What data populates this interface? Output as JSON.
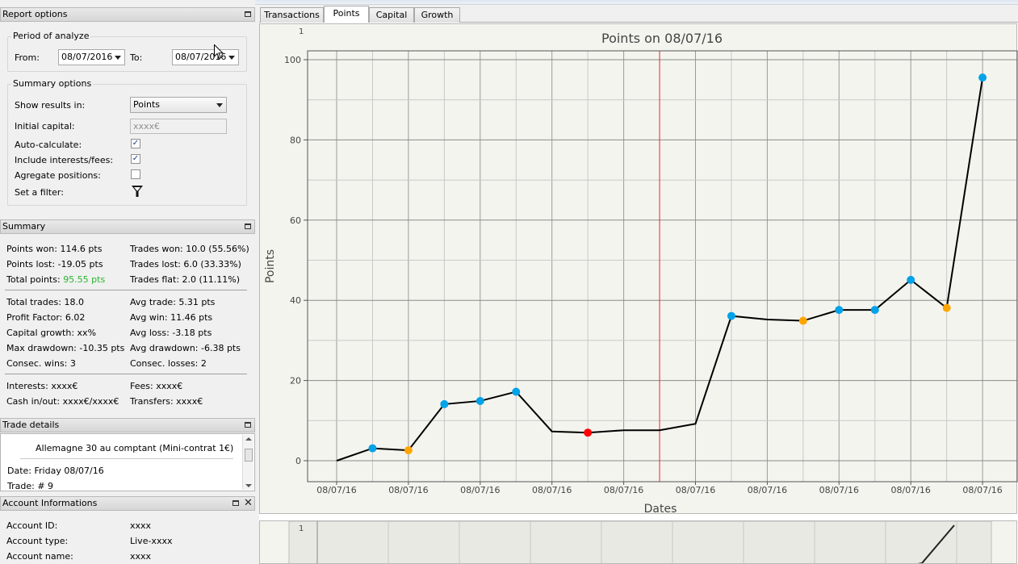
{
  "report_options": {
    "title": "Report options",
    "period": {
      "title": "Period of analyze",
      "from_label": "From:",
      "from_value": "08/07/2016",
      "to_label": "To:",
      "to_value": "08/07/2016"
    },
    "summary_options": {
      "title": "Summary options",
      "show_results_label": "Show results in:",
      "show_results_value": "Points",
      "initial_capital_label": "Initial capital:",
      "initial_capital_placeholder": "xxxx€",
      "auto_calculate_label": "Auto-calculate:",
      "auto_calculate_checked": true,
      "include_interests_label": "Include interests/fees:",
      "include_interests_checked": true,
      "aggregate_label": "Agregate positions:",
      "aggregate_checked": false,
      "filter_label": "Set a filter:"
    }
  },
  "summary": {
    "title": "Summary",
    "points_won": "Points won: 114.6 pts",
    "trades_won": "Trades won: 10.0 (55.56%)",
    "points_lost": "Points lost: -19.05 pts",
    "trades_lost": "Trades lost: 6.0 (33.33%)",
    "total_points_label": "Total points:",
    "total_points_value": "95.55 pts",
    "trades_flat": "Trades flat: 2.0 (11.11%)",
    "total_trades": "Total trades: 18.0",
    "avg_trade": "Avg trade: 5.31 pts",
    "profit_factor": "Profit Factor: 6.02",
    "avg_win": "Avg win: 11.46 pts",
    "capital_growth": "Capital growth: xx%",
    "avg_loss": "Avg loss: -3.18 pts",
    "max_drawdown": "Max drawdown: -10.35 pts",
    "avg_drawdown": "Avg drawdown: -6.38 pts",
    "consec_wins": "Consec. wins: 3",
    "consec_losses": "Consec. losses: 2",
    "interests": "Interests: xxxx€",
    "fees": "Fees: xxxx€",
    "cash_inout": "Cash in/out: xxxx€/xxxx€",
    "transfers": "Transfers: xxxx€"
  },
  "trade_details": {
    "title": "Trade details",
    "instrument": "Allemagne 30 au comptant (Mini-contrat 1€)",
    "date": "Date: Friday 08/07/16",
    "trade": "Trade: # 9"
  },
  "account": {
    "title": "Account Informations",
    "rows": [
      {
        "label": "Account ID:",
        "value": "xxxx"
      },
      {
        "label": "Account type:",
        "value": "Live-xxxx"
      },
      {
        "label": "Account name:",
        "value": "xxxx"
      }
    ]
  },
  "tabs": [
    {
      "label": "Transactions",
      "active": false
    },
    {
      "label": "Points",
      "active": true
    },
    {
      "label": "Capital",
      "active": false
    },
    {
      "label": "Growth",
      "active": false
    }
  ],
  "colors": {
    "win": "#00a2e8",
    "flat": "#ffa500",
    "loss": "#ff0000",
    "line": "#000000",
    "marker_line": "#e03030",
    "total_points": "#29b52e"
  },
  "chart_data": {
    "type": "line",
    "title": "Points on 08/07/16",
    "xlabel": "Dates",
    "ylabel": "Points",
    "corner_text": "1",
    "ylim": [
      -5,
      100
    ],
    "yticks": [
      0,
      20,
      40,
      60,
      80,
      100
    ],
    "x_tick_labels": [
      "08/07/16",
      "08/07/16",
      "08/07/16",
      "08/07/16",
      "08/07/16",
      "08/07/16",
      "08/07/16",
      "08/07/16",
      "08/07/16",
      "08/07/16"
    ],
    "grid": true,
    "vertical_marker_index": 9,
    "points": [
      {
        "y": 0,
        "status": "none"
      },
      {
        "y": 3.1,
        "status": "win"
      },
      {
        "y": 2.6,
        "status": "flat"
      },
      {
        "y": 14.1,
        "status": "win"
      },
      {
        "y": 14.9,
        "status": "win"
      },
      {
        "y": 17.2,
        "status": "win"
      },
      {
        "y": 7.3,
        "status": "none"
      },
      {
        "y": 7.0,
        "status": "loss"
      },
      {
        "y": 7.6,
        "status": "none"
      },
      {
        "y": 7.6,
        "status": "none"
      },
      {
        "y": 9.2,
        "status": "none"
      },
      {
        "y": 36.1,
        "status": "win"
      },
      {
        "y": 35.2,
        "status": "none"
      },
      {
        "y": 34.9,
        "status": "flat"
      },
      {
        "y": 37.6,
        "status": "win"
      },
      {
        "y": 37.6,
        "status": "win"
      },
      {
        "y": 45.1,
        "status": "win"
      },
      {
        "y": 38.1,
        "status": "flat"
      },
      {
        "y": 95.55,
        "status": "win"
      }
    ]
  },
  "mini_chart": {
    "corner_text": "1"
  }
}
